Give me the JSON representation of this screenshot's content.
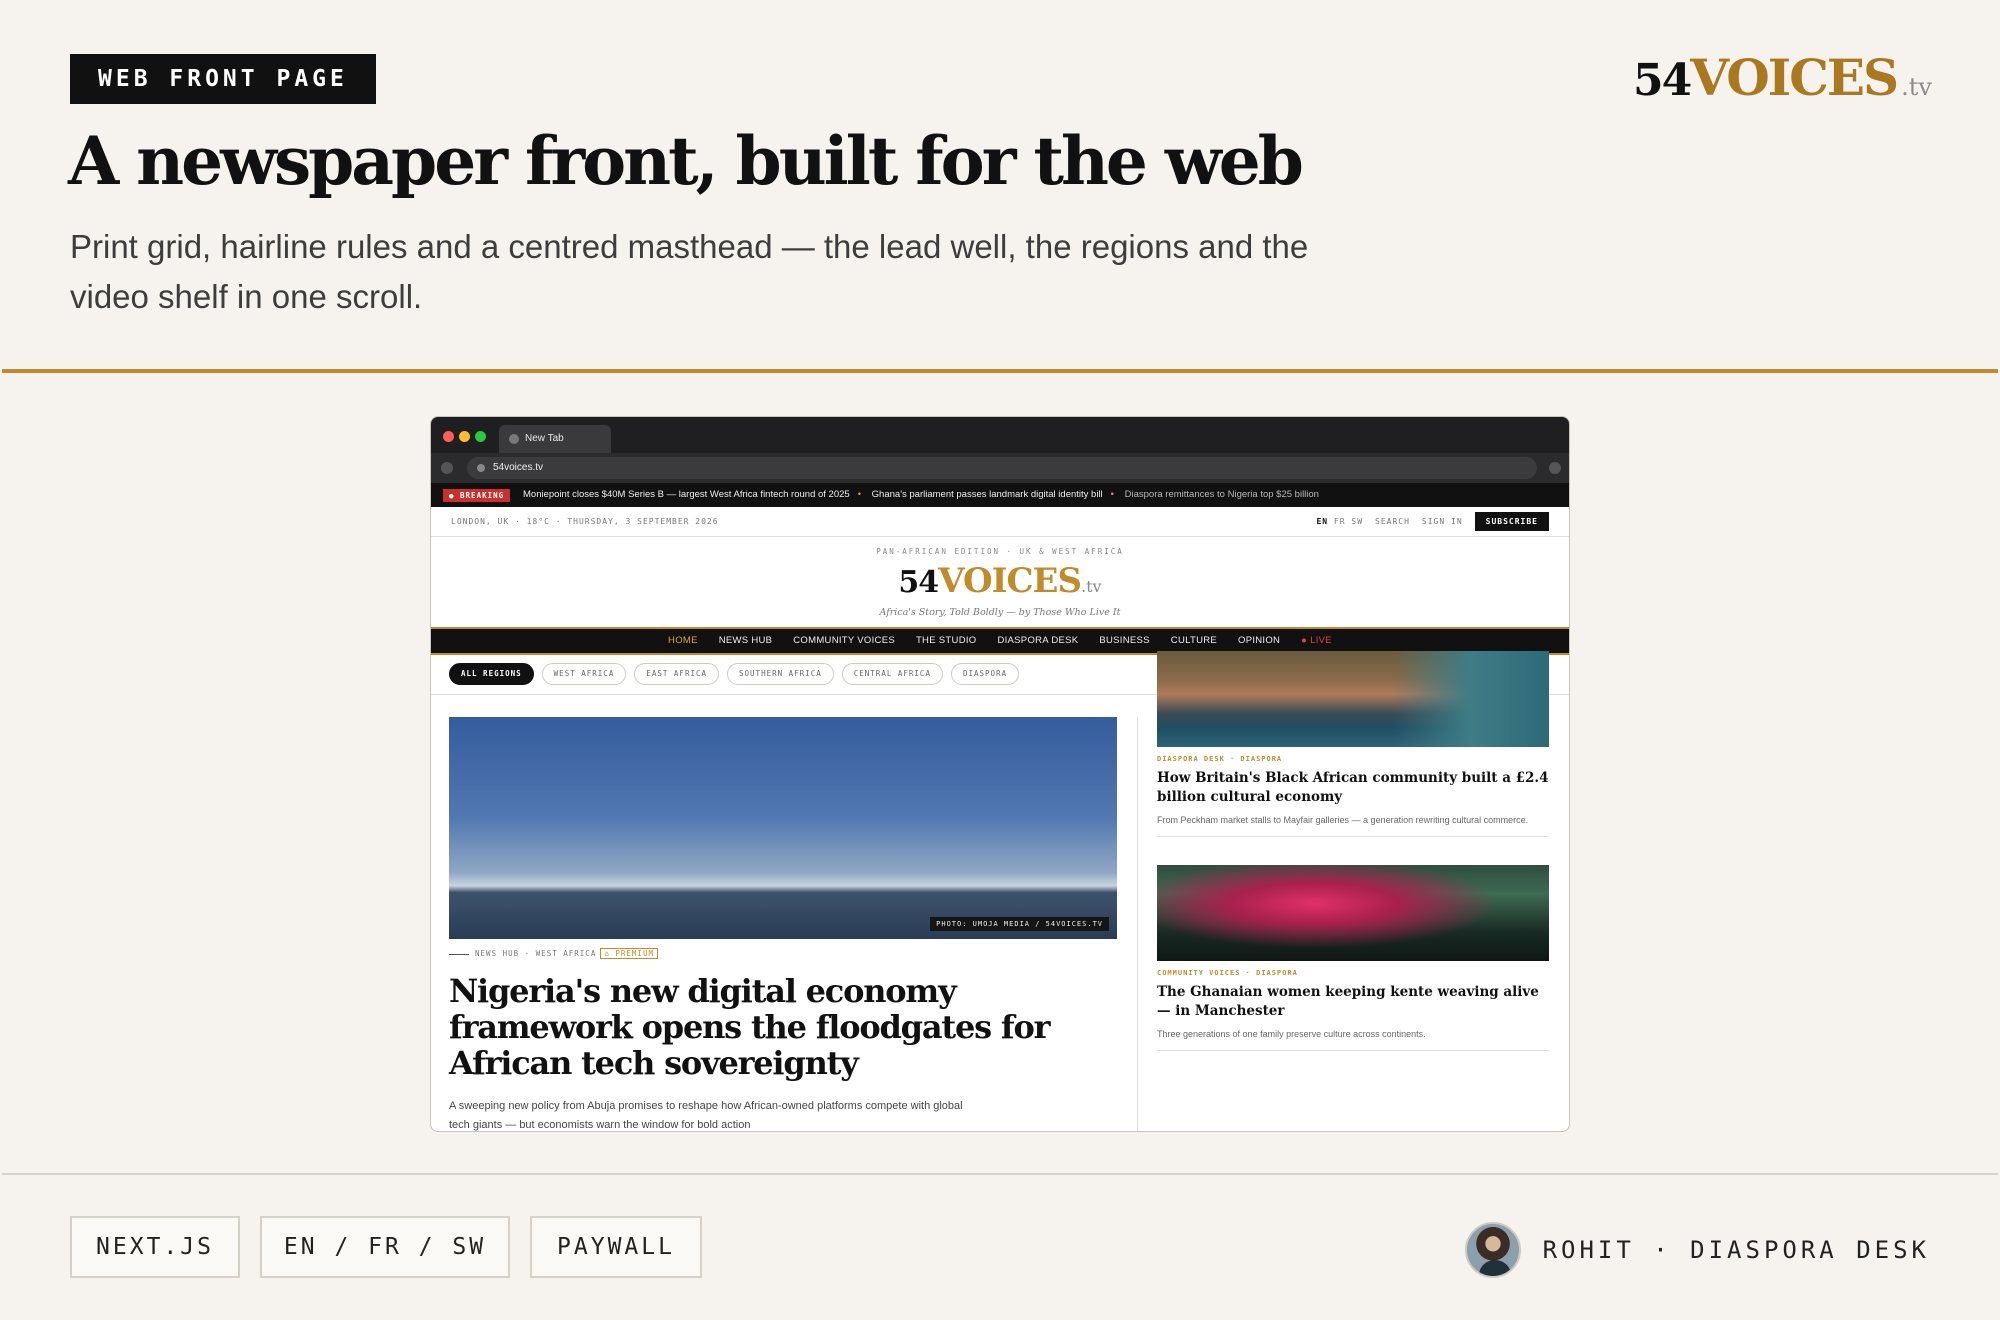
{
  "header": {
    "tag": "WEB FRONT PAGE",
    "brand": {
      "num": "54",
      "word": "VOICES",
      "suffix": ".tv"
    },
    "title": "A newspaper front, built for the web",
    "subtitle": "Print grid, hairline rules and a centred masthead — the lead well, the regions and the video shelf in one scroll."
  },
  "browser": {
    "tab_title": "New Tab",
    "url": "54voices.tv"
  },
  "site": {
    "breaking_label": "● BREAKING",
    "breaking_items": [
      "Moniepoint closes $40M Series B — largest West Africa fintech round of 2025",
      "Ghana's parliament passes landmark digital identity bill",
      "Diaspora remittances to Nigeria top $25 billion"
    ],
    "utility_left": "LONDON, UK · 18°C · THURSDAY, 3 SEPTEMBER 2026",
    "langs": [
      "EN",
      "FR",
      "SW"
    ],
    "search": "SEARCH",
    "sign_in": "SIGN IN",
    "subscribe": "SUBSCRIBE",
    "edition": "PAN-AFRICAN EDITION · UK & WEST AFRICA",
    "logo": {
      "num": "54",
      "word": "VOICES",
      "suffix": ".tv"
    },
    "tagline": "Africa's Story, Told Boldly — by Those Who Live It",
    "nav": [
      "HOME",
      "NEWS HUB",
      "COMMUNITY VOICES",
      "THE STUDIO",
      "DIASPORA DESK",
      "BUSINESS",
      "CULTURE",
      "OPINION",
      "● LIVE"
    ],
    "regions": [
      "ALL REGIONS",
      "WEST AFRICA",
      "EAST AFRICA",
      "SOUTHERN AFRICA",
      "CENTRAL AFRICA",
      "DIASPORA"
    ],
    "lead": {
      "photo_credit": "PHOTO: UMOJA MEDIA / 54VOICES.TV",
      "kicker": "NEWS HUB · WEST AFRICA",
      "premium": "⌂ PREMIUM",
      "title": "Nigeria's new digital economy framework opens the floodgates for African tech sovereignty",
      "dek": "A sweeping new policy from Abuja promises to reshape how African-owned platforms compete with global tech giants — but economists warn the window for bold action"
    },
    "side": [
      {
        "kicker": "DIASPORA DESK · DIASPORA",
        "title": "How Britain's Black African community built a £2.4 billion cultural economy",
        "dek": "From Peckham market stalls to Mayfair galleries — a generation rewriting cultural commerce."
      },
      {
        "kicker": "COMMUNITY VOICES · DIASPORA",
        "title": "The Ghanaian women keeping kente weaving alive — in Manchester",
        "dek": "Three generations of one family preserve culture across continents."
      }
    ]
  },
  "footer": {
    "chips": [
      "NEXT.JS",
      "EN / FR / SW",
      "PAYWALL"
    ],
    "author": "ROHIT · DIASPORA DESK"
  },
  "colors": {
    "accent": "#c18a2a",
    "ink": "#111111",
    "background": "#f6f3ee",
    "breaking": "#c9302c"
  }
}
